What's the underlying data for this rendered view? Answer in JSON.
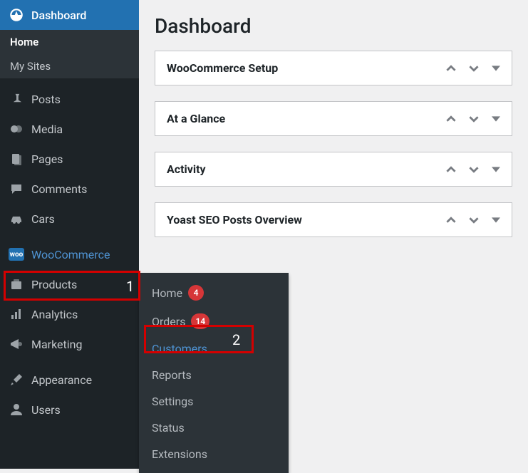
{
  "page": {
    "title": "Dashboard"
  },
  "sidebar": {
    "dashboard": "Dashboard",
    "home": "Home",
    "mysites": "My Sites",
    "posts": "Posts",
    "media": "Media",
    "pages": "Pages",
    "comments": "Comments",
    "cars": "Cars",
    "woocommerce": "WooCommerce",
    "products": "Products",
    "analytics": "Analytics",
    "marketing": "Marketing",
    "appearance": "Appearance",
    "users": "Users"
  },
  "submenu": {
    "home": "Home",
    "home_badge": "4",
    "orders": "Orders",
    "orders_badge": "14",
    "customers": "Customers",
    "reports": "Reports",
    "settings": "Settings",
    "status": "Status",
    "extensions": "Extensions"
  },
  "postboxes": {
    "a": "WooCommerce Setup",
    "b": "At a Glance",
    "c": "Activity",
    "d": "Yoast SEO Posts Overview"
  },
  "callouts": {
    "one": "1",
    "two": "2"
  }
}
